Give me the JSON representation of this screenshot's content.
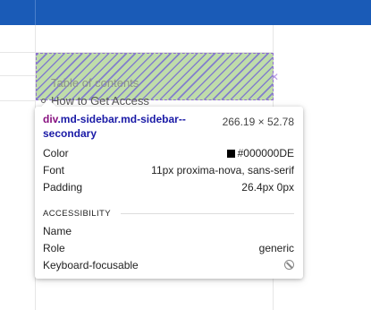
{
  "page": {
    "behind_text": "Table of contents",
    "behind_link": "How to Get Access"
  },
  "tooltip": {
    "selector_tag": "div",
    "selector_class": ".md-sidebar.md-sidebar--secondary",
    "dimensions": "266.19 × 52.78",
    "rows": [
      {
        "label": "Color",
        "value": "#000000DE",
        "swatch_color": "#000000"
      },
      {
        "label": "Font",
        "value": "11px proxima-nova, sans-serif"
      },
      {
        "label": "Padding",
        "value": "26.4px 0px"
      }
    ],
    "accessibility": {
      "heading": "ACCESSIBILITY",
      "rows": [
        {
          "label": "Name",
          "value": ""
        },
        {
          "label": "Role",
          "value": "generic"
        },
        {
          "label": "Keyboard-focusable",
          "icon": "not-focusable-icon"
        }
      ]
    }
  },
  "colors": {
    "topbar": "#1a5bb7",
    "highlight_fill": "#bfdcaa",
    "selector_class": "#1a1aa6",
    "selector_tag": "#881280"
  }
}
